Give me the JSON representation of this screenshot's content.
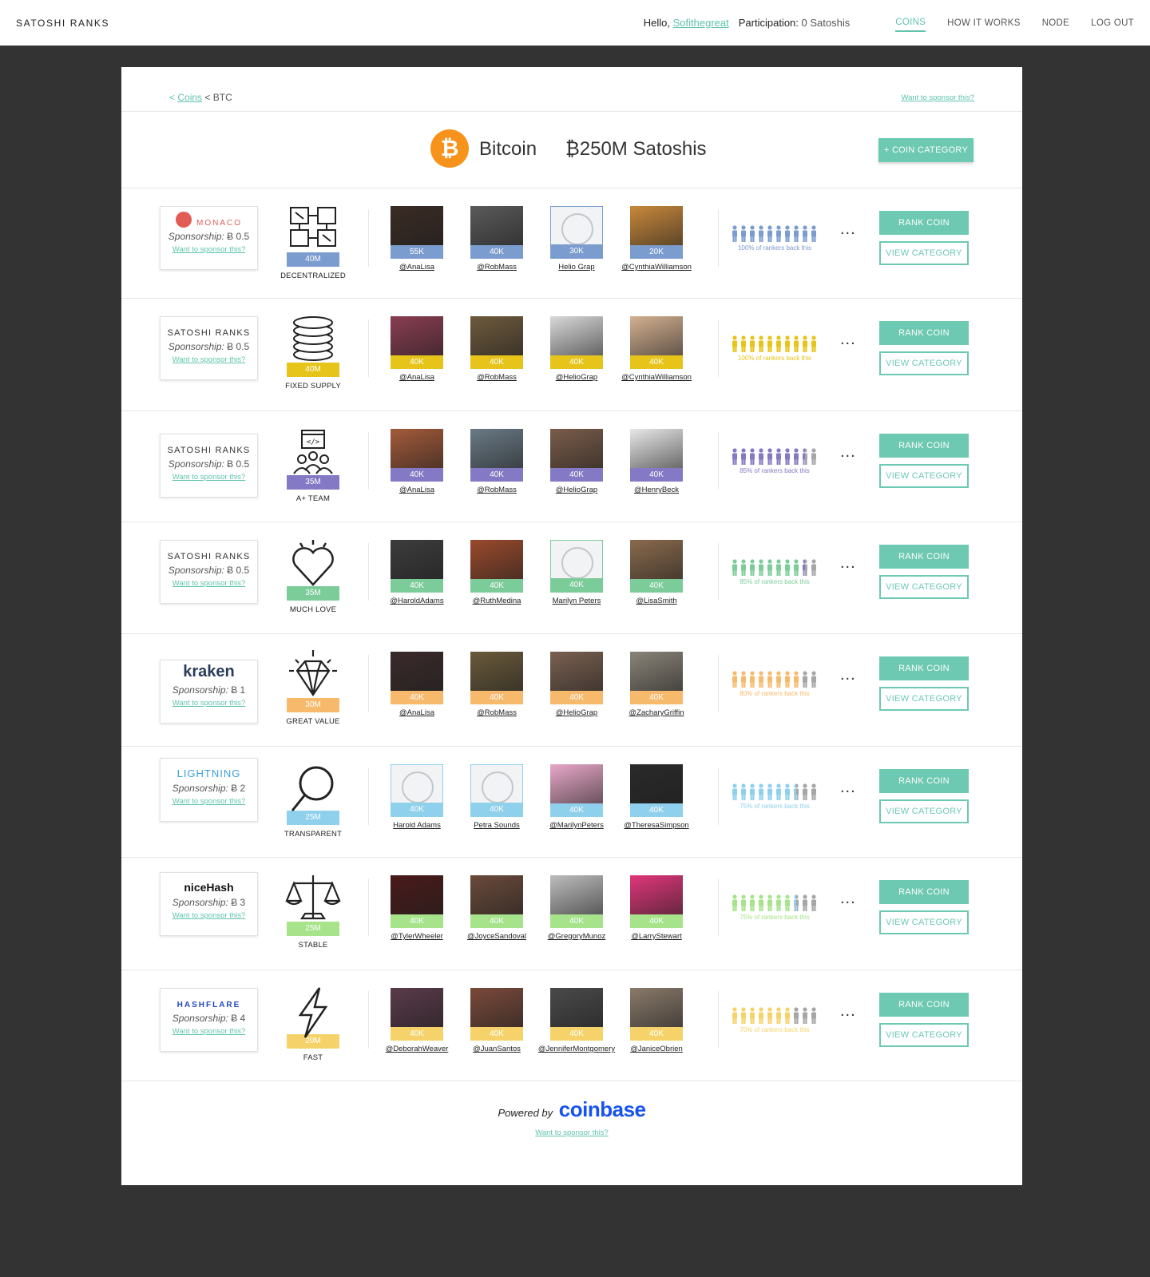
{
  "topbar": {
    "brand": "SATOSHI RANKS",
    "hello": "Hello,",
    "username": "Sofithegreat",
    "participation_label": "Participation:",
    "participation_value": "0 Satoshis",
    "nav": [
      "COINS",
      "HOW IT WORKS",
      "NODE",
      "LOG OUT"
    ]
  },
  "breadcrumb": {
    "lt": "<",
    "coins": "Coins",
    "sep": "< BTC"
  },
  "sponsor_top": "Want to sponsor this?",
  "coin": {
    "symbol": "₿",
    "name": "Bitcoin",
    "satoshis": "₿250M Satoshis",
    "add_category": "+ COIN CATEGORY"
  },
  "buttons": {
    "rank": "RANK COIN",
    "view": "VIEW CATEGORY"
  },
  "dots": "...",
  "rows": [
    {
      "color": "#7b9ccf",
      "sponsor": {
        "logo": "MONACO",
        "line": "Sponsorship:",
        "amount": "Ƀ 0.5",
        "link": "Want to sponsor this?"
      },
      "category": {
        "icon": "blocks-icon",
        "amount": "40M",
        "name": "DECENTRALIZED"
      },
      "rankers": [
        {
          "score": "55K",
          "handle": "@AnaLisa",
          "photo": "#3a2b24"
        },
        {
          "score": "40K",
          "handle": "@RobMass",
          "photo": "#5a5a5a"
        },
        {
          "score": "30K",
          "handle": "Helio Grap",
          "placeholder": true
        },
        {
          "score": "20K",
          "handle": "@CynthiaWilliamson",
          "photo": "#c8883b"
        }
      ],
      "backs": "100% of rankers back this",
      "backed": 10
    },
    {
      "color": "#e6c419",
      "sponsor": {
        "logo": "SATOSHI RANKS",
        "line": "Sponsorship:",
        "amount": "Ƀ 0.5",
        "link": "Want to sponsor this?"
      },
      "category": {
        "icon": "coins-stack-icon",
        "amount": "40M",
        "name": "FIXED SUPPLY"
      },
      "rankers": [
        {
          "score": "40K",
          "handle": "@AnaLisa",
          "photo": "#8a3d52"
        },
        {
          "score": "40K",
          "handle": "@RobMass",
          "photo": "#6e5a3c"
        },
        {
          "score": "40K",
          "handle": "@HelioGrap",
          "photo": "#d9d9d9"
        },
        {
          "score": "40K",
          "handle": "@CynthiaWilliamson",
          "photo": "#d4b090"
        }
      ],
      "backs": "100% of rankers back this",
      "backed": 10
    },
    {
      "color": "#8479c4",
      "sponsor": {
        "logo": "SATOSHI RANKS",
        "line": "Sponsorship:",
        "amount": "Ƀ 0.5",
        "link": "Want to sponsor this?"
      },
      "category": {
        "icon": "team-code-icon",
        "amount": "35M",
        "name": "A+ TEAM"
      },
      "rankers": [
        {
          "score": "40K",
          "handle": "@AnaLisa",
          "photo": "#a45a3a"
        },
        {
          "score": "40K",
          "handle": "@RobMass",
          "photo": "#6a7a86"
        },
        {
          "score": "40K",
          "handle": "@HelioGrap",
          "photo": "#7a5c4a"
        },
        {
          "score": "40K",
          "handle": "@HenryBeck",
          "photo": "#e8e8e8"
        }
      ],
      "backs": "85% of rankers back this",
      "backed": 8.5
    },
    {
      "color": "#7ccc99",
      "sponsor": {
        "logo": "SATOSHI RANKS",
        "line": "Sponsorship:",
        "amount": "Ƀ 0.5",
        "link": "Want to sponsor this?"
      },
      "category": {
        "icon": "heart-icon",
        "amount": "35M",
        "name": "MUCH LOVE"
      },
      "rankers": [
        {
          "score": "40K",
          "handle": "@HaroldAdams",
          "photo": "#3c3c3c"
        },
        {
          "score": "40K",
          "handle": "@RuthMedina",
          "photo": "#9a4a2c"
        },
        {
          "score": "40K",
          "handle": "Marilyn Peters",
          "placeholder": true
        },
        {
          "score": "40K",
          "handle": "@LisaSmith",
          "photo": "#8a6a4c"
        }
      ],
      "backs": "85% of rankers back this",
      "backed": 8.5
    },
    {
      "color": "#f7ba6c",
      "sponsor": {
        "logo": "kraken",
        "line": "Sponsorship:",
        "amount": "Ƀ 1",
        "link": "Want to sponsor this?"
      },
      "category": {
        "icon": "diamond-icon",
        "amount": "30M",
        "name": "GREAT VALUE"
      },
      "rankers": [
        {
          "score": "40K",
          "handle": "@AnaLisa",
          "photo": "#3a2a2a"
        },
        {
          "score": "40K",
          "handle": "@RobMass",
          "photo": "#6a5a3a"
        },
        {
          "score": "40K",
          "handle": "@HelioGrap",
          "photo": "#7a6050"
        },
        {
          "score": "40K",
          "handle": "@ZacharyGriffin",
          "photo": "#8a8478"
        }
      ],
      "backs": "80% of rankers back this",
      "backed": 8
    },
    {
      "color": "#8fd0ec",
      "sponsor": {
        "logo": "LIGHTNING",
        "line": "Sponsorship:",
        "amount": "Ƀ 2",
        "link": "Want to sponsor this?"
      },
      "category": {
        "icon": "magnifier-icon",
        "amount": "25M",
        "name": "TRANSPARENT"
      },
      "rankers": [
        {
          "score": "40K",
          "handle": "Harold Adams",
          "placeholder": true
        },
        {
          "score": "40K",
          "handle": "Petra Sounds",
          "placeholder": true
        },
        {
          "score": "40K",
          "handle": "@MarilynPeters",
          "photo": "#e8a8c8"
        },
        {
          "score": "40K",
          "handle": "@TheresaSimpson",
          "photo": "#2a2a2a"
        }
      ],
      "backs": "75% of rankers back this",
      "backed": 7.5
    },
    {
      "color": "#a6e38a",
      "sponsor": {
        "logo": "niceHash",
        "line": "Sponsorship:",
        "amount": "Ƀ 3",
        "link": "Want to sponsor this?"
      },
      "category": {
        "icon": "scales-icon",
        "amount": "25M",
        "name": "STABLE"
      },
      "rankers": [
        {
          "score": "40K",
          "handle": "@TylerWheeler",
          "photo": "#4a1a1a"
        },
        {
          "score": "40K",
          "handle": "@JoyceSandoval",
          "photo": "#6a4a3a"
        },
        {
          "score": "40K",
          "handle": "@GregoryMunoz",
          "photo": "#bdbdbd"
        },
        {
          "score": "40K",
          "handle": "@LarryStewart",
          "photo": "#e0367a"
        }
      ],
      "backs": "75% of rankers back this",
      "backed": 7.5
    },
    {
      "color": "#f5d36a",
      "sponsor": {
        "logo": "HASHFLARE",
        "line": "Sponsorship:",
        "amount": "Ƀ 4",
        "link": "Want to sponsor this?"
      },
      "category": {
        "icon": "lightning-bolt-icon",
        "amount": "20M",
        "name": "FAST"
      },
      "rankers": [
        {
          "score": "40K",
          "handle": "@DeborahWeaver",
          "photo": "#5a3a4a"
        },
        {
          "score": "40K",
          "handle": "@JuanSantos",
          "photo": "#7a4a3a"
        },
        {
          "score": "40K",
          "handle": "@JenniferMontgomery",
          "photo": "#4a4a4a"
        },
        {
          "score": "40K",
          "handle": "@JaniceObrien",
          "photo": "#8a7a6a"
        }
      ],
      "backs": "70% of rankers back this",
      "backed": 7
    }
  ],
  "footer": {
    "powered": "Powered by",
    "brand": "coinbase",
    "link": "Want to sponsor this?"
  }
}
